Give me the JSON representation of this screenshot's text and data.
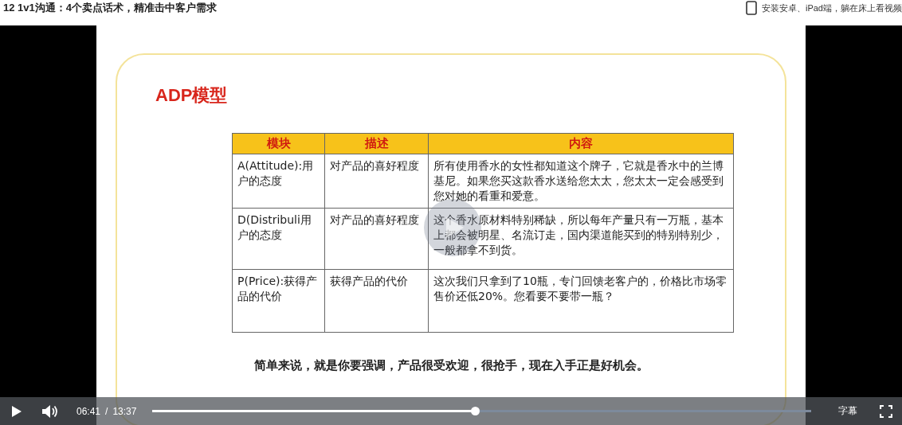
{
  "page_title": "12 1v1沟通：4个卖点话术，精准击中客户需求",
  "app_promo": "安装安卓、iPad端，躺在床上看视频",
  "slide": {
    "heading": "ADP模型",
    "table": {
      "columns": [
        "模块",
        "描述",
        "内容"
      ],
      "rows": [
        [
          "A(Attitude):用户的态度",
          "对产品的喜好程度",
          "所有使用香水的女性都知道这个牌子，它就是香水中的兰博基尼。如果您买这款香水送给您太太，您太太一定会感受到您对她的看重和爱意。"
        ],
        [
          "D(Distribuli用户的态度",
          "对产品的喜好程度",
          "这个香水原材料特别稀缺，所以每年产量只有一万瓶，基本上都会被明星、名流订走，国内渠道能买到的特别特别少，一般都拿不到货。"
        ],
        [
          "P(Price):获得产品的代价",
          "获得产品的代价",
          "这次我们只拿到了10瓶，专门回馈老客户的，价格比市场零售价还低20%。您看要不要带一瓶？"
        ]
      ]
    },
    "summary": "简单来说，就是你要强调，产品很受欢迎，很抢手，现在入手正是好机会。"
  },
  "player": {
    "playing": false,
    "current_time": "06:41",
    "separator": "/",
    "duration": "13:37",
    "progress": {
      "level": 0.49
    },
    "subtitles": "字幕"
  }
}
